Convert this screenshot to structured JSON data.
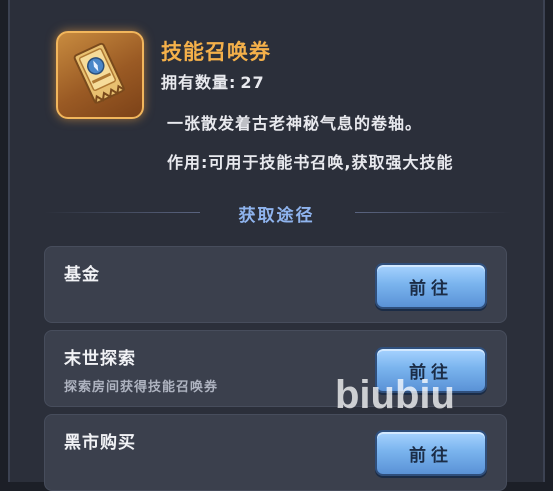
{
  "item": {
    "name": "技能召唤券",
    "owned_label": "拥有数量:",
    "owned_count": "27",
    "description": "一张散发着古老神秘气息的卷轴。",
    "usage": "作用:可用于技能书召唤,获取强大技能",
    "icon": "ticket-scroll-icon"
  },
  "section_title": "获取途径",
  "sources": [
    {
      "title": "基金",
      "subtitle": "",
      "button": "前往"
    },
    {
      "title": "末世探索",
      "subtitle": "探索房间获得技能召唤券",
      "button": "前往"
    },
    {
      "title": "黑市购买",
      "subtitle": "",
      "button": "前往"
    }
  ],
  "watermark": "biubiu",
  "colors": {
    "title_gold": "#f4b04a",
    "section_blue": "#8fb4ee",
    "button_blue": "#7ab4ee"
  }
}
